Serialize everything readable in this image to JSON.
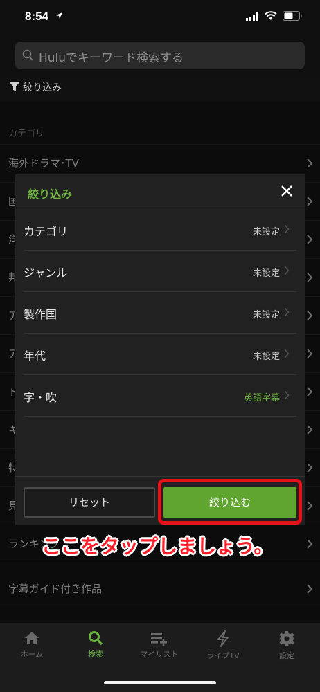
{
  "status_bar": {
    "time": "8:54"
  },
  "search": {
    "placeholder": "Huluでキーワード検索する"
  },
  "filter": {
    "label": "絞り込み"
  },
  "list": {
    "section_header": "カテゴリ",
    "items": [
      {
        "label": "海外ドラマ･TV"
      },
      {
        "label": "国"
      },
      {
        "label": "洋"
      },
      {
        "label": "邦"
      },
      {
        "label": "ア"
      },
      {
        "label": "ア"
      },
      {
        "label": "ド"
      },
      {
        "label": "キ"
      },
      {
        "label": "特"
      },
      {
        "label": "見"
      },
      {
        "label": "ランキング"
      },
      {
        "label": "字幕ガイド付き作品"
      }
    ]
  },
  "modal": {
    "title": "絞り込み",
    "rows": [
      {
        "label": "カテゴリ",
        "value": "未設定"
      },
      {
        "label": "ジャンル",
        "value": "未設定"
      },
      {
        "label": "製作国",
        "value": "未設定"
      },
      {
        "label": "年代",
        "value": "未設定"
      },
      {
        "label": "字・吹",
        "value": "英語字幕"
      }
    ],
    "reset_label": "リセット",
    "apply_label": "絞り込む"
  },
  "annotation": {
    "text": "ここをタップしましょう。"
  },
  "tabs": [
    {
      "label": "ホーム",
      "icon": "home-icon"
    },
    {
      "label": "検索",
      "icon": "search-icon",
      "active": true
    },
    {
      "label": "マイリスト",
      "icon": "mylist-icon"
    },
    {
      "label": "ライブTV",
      "icon": "lightning-icon"
    },
    {
      "label": "設定",
      "icon": "gear-icon"
    }
  ],
  "colors": {
    "accent": "#6db33f",
    "highlight": "#e8101b",
    "annotation_text": "#ff1f2b"
  }
}
